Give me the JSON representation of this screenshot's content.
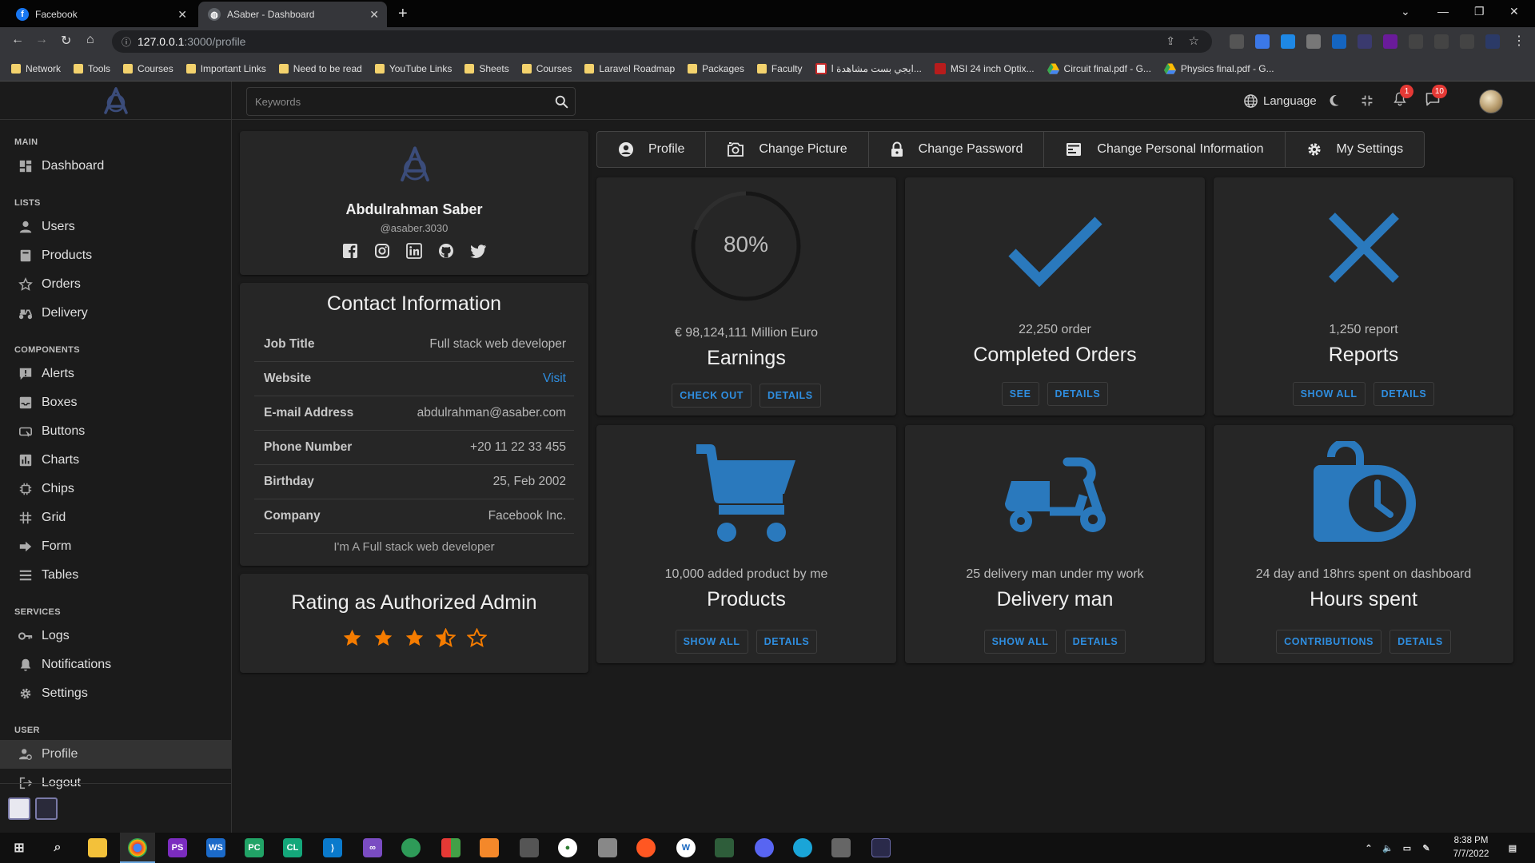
{
  "browser": {
    "tabs": [
      {
        "title": "Facebook",
        "favicon": "facebook-icon",
        "active": false
      },
      {
        "title": "ASaber - Dashboard",
        "favicon": "globe-icon",
        "active": true
      }
    ],
    "url_host": "127.0.0.1",
    "url_path": ":3000/profile",
    "bookmarks": [
      {
        "label": "Network",
        "icon": "folder-icon"
      },
      {
        "label": "Tools",
        "icon": "folder-icon"
      },
      {
        "label": "Courses",
        "icon": "folder-icon"
      },
      {
        "label": "Important Links",
        "icon": "folder-icon"
      },
      {
        "label": "Need to be read",
        "icon": "folder-icon"
      },
      {
        "label": "YouTube Links",
        "icon": "folder-icon"
      },
      {
        "label": "Sheets",
        "icon": "folder-icon"
      },
      {
        "label": "Courses",
        "icon": "folder-icon"
      },
      {
        "label": "Laravel Roadmap",
        "icon": "folder-icon"
      },
      {
        "label": "Packages",
        "icon": "folder-icon"
      },
      {
        "label": "Faculty",
        "icon": "folder-icon"
      },
      {
        "label": "ايجي بست مشاهدة ا...",
        "icon": "site-icon"
      },
      {
        "label": "MSI 24 inch Optix...",
        "icon": "msi-icon"
      },
      {
        "label": "Circuit final.pdf - G...",
        "icon": "drive-icon"
      },
      {
        "label": "Physics final.pdf - G...",
        "icon": "drive-icon"
      }
    ]
  },
  "sidebar": {
    "sections": [
      {
        "title": "MAIN",
        "items": [
          {
            "label": "Dashboard",
            "icon": "dashboard-icon"
          }
        ]
      },
      {
        "title": "LISTS",
        "items": [
          {
            "label": "Users",
            "icon": "user-icon"
          },
          {
            "label": "Products",
            "icon": "box-icon"
          },
          {
            "label": "Orders",
            "icon": "star-icon"
          },
          {
            "label": "Delivery",
            "icon": "scooter-icon"
          }
        ]
      },
      {
        "title": "COMPONENTS",
        "items": [
          {
            "label": "Alerts",
            "icon": "alert-icon"
          },
          {
            "label": "Boxes",
            "icon": "inbox-icon"
          },
          {
            "label": "Buttons",
            "icon": "button-icon"
          },
          {
            "label": "Charts",
            "icon": "chart-icon"
          },
          {
            "label": "Chips",
            "icon": "chip-icon"
          },
          {
            "label": "Grid",
            "icon": "grid-icon"
          },
          {
            "label": "Form",
            "icon": "arrow-icon"
          },
          {
            "label": "Tables",
            "icon": "list-icon"
          }
        ]
      },
      {
        "title": "SERVICES",
        "items": [
          {
            "label": "Logs",
            "icon": "key-icon"
          },
          {
            "label": "Notifications",
            "icon": "bell-icon"
          },
          {
            "label": "Settings",
            "icon": "gear-icon"
          }
        ]
      },
      {
        "title": "USER",
        "items": [
          {
            "label": "Profile",
            "icon": "user-gear-icon",
            "active": true
          },
          {
            "label": "Logout",
            "icon": "logout-icon"
          }
        ]
      }
    ]
  },
  "topbar": {
    "search_placeholder": "Keywords",
    "language_label": "Language",
    "notifications_count": "1",
    "messages_count": "10"
  },
  "profile": {
    "name": "Abdulrahman Saber",
    "handle": "@asaber.3030",
    "socials": [
      "facebook-icon",
      "instagram-icon",
      "linkedin-icon",
      "github-icon",
      "twitter-icon"
    ]
  },
  "contact": {
    "title": "Contact Information",
    "rows": [
      {
        "key": "Job Title",
        "value": "Full stack web developer",
        "link": false
      },
      {
        "key": "Website",
        "value": "Visit",
        "link": true
      },
      {
        "key": "E-mail Address",
        "value": "abdulrahman@asaber.com",
        "link": false
      },
      {
        "key": "Phone Number",
        "value": "+20 11 22 33 455",
        "link": false
      },
      {
        "key": "Birthday",
        "value": "25, Feb 2002",
        "link": false
      },
      {
        "key": "Company",
        "value": "Facebook Inc.",
        "link": false
      }
    ],
    "bio": "I'm A Full stack web developer"
  },
  "rating": {
    "title": "Rating as Authorized Admin",
    "value": 3.5,
    "max": 5
  },
  "profile_tabs": [
    {
      "label": "Profile",
      "icon": "user-circle-icon"
    },
    {
      "label": "Change Picture",
      "icon": "camera-icon"
    },
    {
      "label": "Change Password",
      "icon": "lock-icon"
    },
    {
      "label": "Change Personal Information",
      "icon": "id-card-icon"
    },
    {
      "label": "My Settings",
      "icon": "gear-icon"
    }
  ],
  "stats": [
    {
      "sub": "€ 98,124,111 Million Euro",
      "title": "Earnings",
      "visual": "progress-ring",
      "percent": 80,
      "percent_label": "80%",
      "buttons": [
        "CHECK OUT",
        "DETAILS"
      ]
    },
    {
      "sub": "22,250 order",
      "title": "Completed Orders",
      "visual": "check-icon",
      "buttons": [
        "SEE",
        "DETAILS"
      ]
    },
    {
      "sub": "1,250 report",
      "title": "Reports",
      "visual": "x-icon",
      "buttons": [
        "SHOW ALL",
        "DETAILS"
      ]
    },
    {
      "sub": "10,000 added product by me",
      "title": "Products",
      "visual": "cart-icon",
      "buttons": [
        "SHOW ALL",
        "DETAILS"
      ]
    },
    {
      "sub": "25 delivery man under my work",
      "title": "Delivery man",
      "visual": "scooter-icon",
      "buttons": [
        "SHOW ALL",
        "DETAILS"
      ]
    },
    {
      "sub": "24 day and 18hrs spent on dashboard",
      "title": "Hours spent",
      "visual": "clock-bag-icon",
      "buttons": [
        "CONTRIBUTIONS",
        "DETAILS"
      ]
    }
  ],
  "taskbar": {
    "time": "8:38 PM",
    "date": "7/7/2022"
  },
  "colors": {
    "accent": "#2f8ee0",
    "icon_blue": "#2a79bd",
    "star": "#f57c00",
    "badge": "#e53935"
  }
}
